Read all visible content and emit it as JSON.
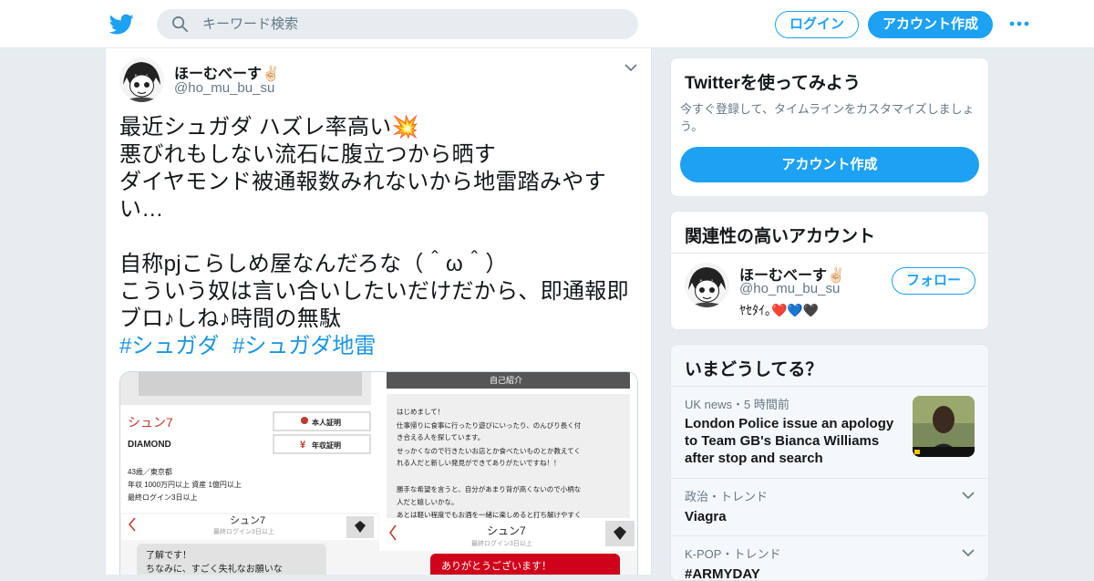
{
  "header": {
    "search_placeholder": "キーワード検索",
    "login_label": "ログイン",
    "signup_label": "アカウント作成"
  },
  "tweet": {
    "name": "ほーむべーす✌🏻",
    "handle": "@ho_mu_bu_su",
    "text": "最近シュガダ ハズレ率高い💥\n悪びれもしない流石に腹立つから晒す\nダイヤモンド被通報数みれないから地雷踏みやすい…\n\n自称pjこらしめ屋なんだろな（＾ω＾）\nこういう奴は言い合いしたいだけだから、即通報即ブロ♪しね♪時間の無駄",
    "hashtags": [
      "#シュガダ",
      "#シュガダ地雷"
    ],
    "media": {
      "left": {
        "name": "シュン7",
        "rank": "DIAMOND",
        "badge1": "本人証明",
        "badge2": "年収証明",
        "line1": "43歳／東京都",
        "line2": "年収 1000万円以上 資産 1億円以上",
        "line3": "最終ログイン3日以上",
        "chat_name": "シュン7",
        "chat_sub": "最終ログイン3日以上",
        "bubble": "了解です！\nちなみに、すごく失礼なお願いな"
      },
      "right": {
        "header": "自己紹介",
        "body": "はじめまして！\n仕事帰りに食事に行ったり遊びにいったり、のんびり長く付き合える人を探しています。\nせっかくなので行きたいお店とか食べたいものとか教えてくれる人だと新しい発見ができてありがたいですね！！\n\n勝手な希望を言うと、自分があまり背が高くないので小柄な人だと嬉しいかな。\nあとは軽い程度でもお酒を一緒に楽しめると打ち解けやすく",
        "chat_name": "シュン7",
        "chat_sub": "最終ログイン3日以上",
        "bubble": "ありがとうございます！"
      }
    }
  },
  "sidebar": {
    "signup_card": {
      "title": "Twitterを使ってみよう",
      "desc": "今すぐ登録して、タイムラインをカスタマイズしましょう。",
      "button": "アカウント作成"
    },
    "related": {
      "title": "関連性の高いアカウント",
      "name": "ほーむべーす✌🏻",
      "handle": "@ho_mu_bu_su",
      "bio": "ﾔｾﾀｲ｡❤️💙🖤",
      "follow": "フォロー"
    },
    "trends": {
      "title": "いまどうしてる？",
      "items": [
        {
          "meta": "UK news・5 時間前",
          "title": "London Police issue an apology to Team GB's Bianca Williams after stop and search"
        },
        {
          "meta": "政治・トレンド",
          "title": "Viagra"
        },
        {
          "meta": "K-POP・トレンド",
          "title": "#ARMYDAY"
        }
      ]
    }
  },
  "colors": {
    "accent": "#1da1f2",
    "background": "#e6ecf0",
    "hashtag": "#1b95e0",
    "red": "#d0021b"
  },
  "icons": [
    "twitter-bird-icon",
    "search-icon",
    "more-dots-icon",
    "chevron-down-icon",
    "user-icon",
    "yen-icon",
    "diamond-icon",
    "back-arrow-icon"
  ]
}
